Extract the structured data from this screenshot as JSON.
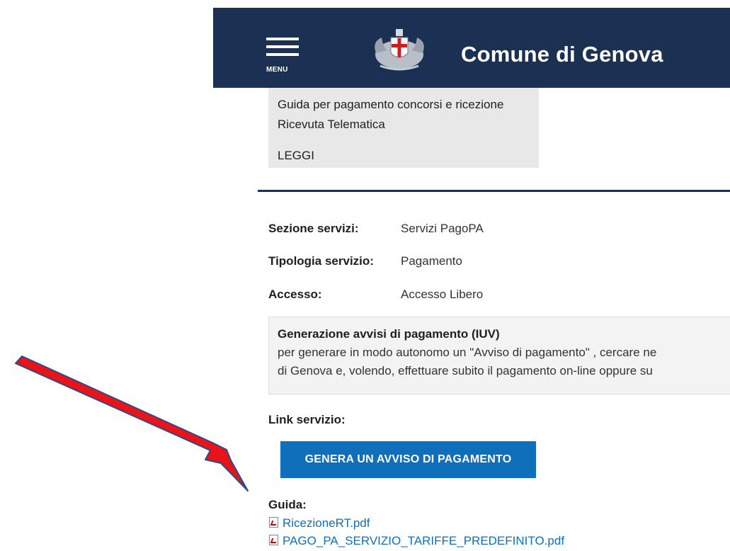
{
  "header": {
    "menu_label": "MENU",
    "site_title": "Comune di Genova",
    "background_color": "#1b3153"
  },
  "guide_card": {
    "text": "Guida per pagamento concorsi e ricezione Ricevuta Telematica",
    "link": "LEGGI"
  },
  "service_info": {
    "sezione": {
      "label": "Sezione servizi:",
      "value": "Servizi PagoPA"
    },
    "tipologia": {
      "label": "Tipologia servizio:",
      "value": "Pagamento"
    },
    "accesso": {
      "label": "Accesso:",
      "value": "Accesso Libero"
    }
  },
  "notice": {
    "title": "Generazione avvisi di pagamento (IUV)",
    "line1": "per generare in modo autonomo un \"Avviso di pagamento\" , cercare ne",
    "line2": "di Genova e, volendo, effettuare subito il pagamento on-line oppure su"
  },
  "link_section": {
    "label": "Link servizio:",
    "button_label": "GENERA UN AVVISO DI PAGAMENTO",
    "button_color": "#0f6fba"
  },
  "guida": {
    "label": "Guida:",
    "files": [
      "RicezioneRT.pdf",
      "PAGO_PA_SERVIZIO_TARIFFE_PREDEFINITO.pdf"
    ]
  },
  "annotation": {
    "arrow_color": "#e8141a",
    "arrow_target": "generate-notice-button"
  }
}
